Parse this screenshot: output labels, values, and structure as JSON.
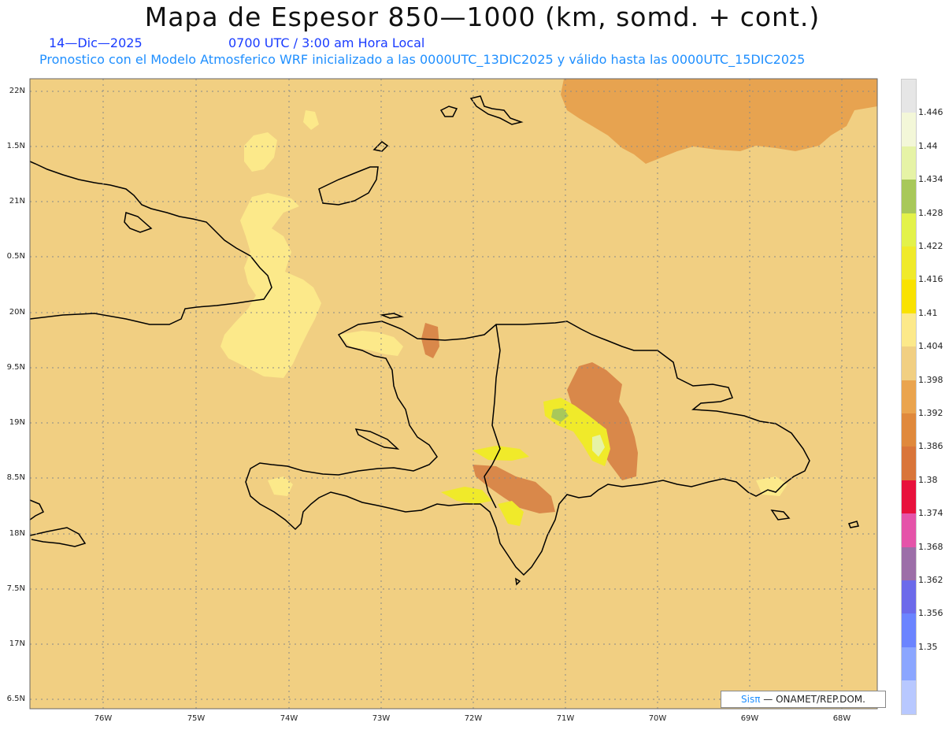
{
  "title": "Mapa de Espesor 850—1000 (km, somd. + cont.)",
  "date_label": "14—Dic—2025",
  "time_label": "0700 UTC / 3:00 am Hora Local",
  "forecast_label": "Pronostico con el Modelo Atmosferico WRF inicializado a las 0000UTC_13DIC2025 y válido hasta las  0000UTC_15DIC2025",
  "credit": {
    "brand": "Sisπ",
    "text": " — ONAMET/REP.DOM."
  },
  "lat_labels": [
    "22N",
    "1.5N",
    "21N",
    "0.5N",
    "20N",
    "9.5N",
    "19N",
    "8.5N",
    "18N",
    "7.5N",
    "17N",
    "6.5N"
  ],
  "lon_labels": [
    "76W",
    "75W",
    "74W",
    "73W",
    "72W",
    "71W",
    "70W",
    "69W",
    "68W"
  ],
  "legend": [
    {
      "label": "",
      "color": "#e6e6e6"
    },
    {
      "label": "1.446",
      "color": "#f3f7d8"
    },
    {
      "label": "1.44",
      "color": "#e6f3a6"
    },
    {
      "label": "1.434",
      "color": "#a8c85a"
    },
    {
      "label": "1.428",
      "color": "#e3f24a"
    },
    {
      "label": "1.422",
      "color": "#f0ea2a"
    },
    {
      "label": "1.416",
      "color": "#f9e200"
    },
    {
      "label": "1.41",
      "color": "#fce98a"
    },
    {
      "label": "1.404",
      "color": "#f1cf82"
    },
    {
      "label": "1.398",
      "color": "#eaa44e"
    },
    {
      "label": "1.392",
      "color": "#e0893c"
    },
    {
      "label": "1.386",
      "color": "#d9753a"
    },
    {
      "label": "1.38",
      "color": "#e8113c"
    },
    {
      "label": "1.374",
      "color": "#e553a9"
    },
    {
      "label": "1.368",
      "color": "#9c6ea8"
    },
    {
      "label": "1.362",
      "color": "#6c6aea"
    },
    {
      "label": "1.356",
      "color": "#6b84ff"
    },
    {
      "label": "1.35",
      "color": "#8ba6ff"
    },
    {
      "label": "",
      "color": "#b8c8ff"
    }
  ],
  "colors": {
    "background_field": "#f1cf82",
    "low_field": "#e7a350",
    "low_field_dark": "#d9884a",
    "coast": "#000000",
    "grid": "#888888"
  }
}
